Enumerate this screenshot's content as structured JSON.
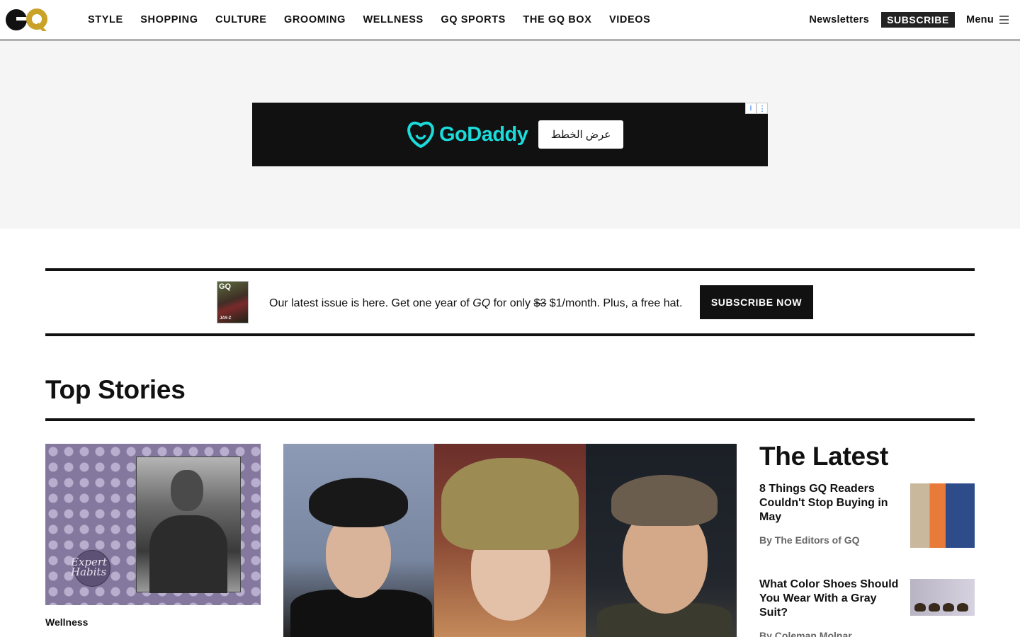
{
  "header": {
    "logo_alt": "GQ",
    "nav": [
      "STYLE",
      "SHOPPING",
      "CULTURE",
      "GROOMING",
      "WELLNESS",
      "GQ SPORTS",
      "THE GQ BOX",
      "VIDEOS"
    ],
    "newsletters": "Newsletters",
    "subscribe": "SUBSCRIBE",
    "menu": "Menu"
  },
  "ad": {
    "brand": "GoDaddy",
    "cta": "عرض الخطط",
    "info_icon": "i",
    "more_icon": "⋮"
  },
  "promo": {
    "cover_logo": "GQ",
    "cover_name": "JAY-Z",
    "text_before": "Our latest issue is here. Get one year of ",
    "text_brand": "GQ",
    "text_mid": " for only ",
    "old_price": "$3",
    "text_after": " $1/month. Plus, a free hat.",
    "button": "SUBSCRIBE NOW"
  },
  "top_stories": {
    "title": "Top Stories",
    "story1": {
      "kicker": "Wellness",
      "badge": "Expert\nHabits"
    }
  },
  "latest": {
    "title": "The Latest",
    "items": [
      {
        "headline": "8 Things GQ Readers Couldn't Stop Buying in May",
        "byline": "By The Editors of GQ"
      },
      {
        "headline": "What Color Shoes Should You Wear With a Gray Suit?",
        "byline": "By Coleman Molnar"
      }
    ]
  },
  "colors": {
    "accent_gold": "#c9a227",
    "godaddy_teal": "#1bdbdb",
    "ad_bg": "#111111",
    "band_bg": "#f5f5f5"
  }
}
